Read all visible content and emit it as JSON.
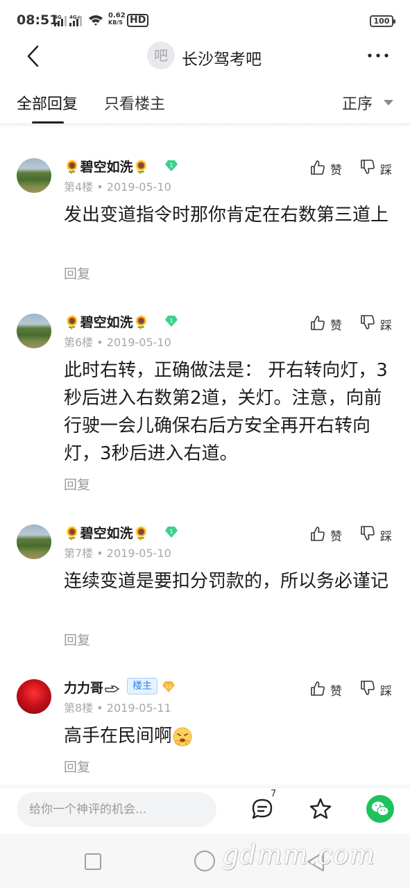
{
  "status_bar": {
    "time": "08:51",
    "network_speed_value": "0.62",
    "network_speed_unit": "KB/S",
    "hd_label": "HD",
    "battery": "100"
  },
  "header": {
    "forum_avatar_glyph": "吧",
    "forum_title": "长沙驾考吧"
  },
  "tabs": {
    "all_replies": "全部回复",
    "owner_only": "只看楼主",
    "sort": "正序"
  },
  "posts": [
    {
      "username": "🌻碧空如洗🌻",
      "level": "1",
      "floor": "第4楼",
      "date": "2019-05-10",
      "content": "发出变道指令时那你肯定在右数第三道上",
      "reply_label": "回复",
      "like_label": "赞",
      "dislike_label": "踩"
    },
    {
      "username": "🌻碧空如洗🌻",
      "level": "1",
      "floor": "第6楼",
      "date": "2019-05-10",
      "content": "此时右转，正确做法是： 开右转向灯，3秒后进入右数第2道，关灯。注意，向前行驶一会儿确保右后方安全再开右转向灯，3秒后进入右道。",
      "reply_label": "回复",
      "like_label": "赞",
      "dislike_label": "踩"
    },
    {
      "username": "🌻碧空如洗🌻",
      "level": "1",
      "floor": "第7楼",
      "date": "2019-05-10",
      "content": "连续变道是要扣分罚款的，所以务必谨记",
      "reply_label": "回复",
      "like_label": "赞",
      "dislike_label": "踩"
    },
    {
      "username": "力力哥",
      "owner_badge": "楼主",
      "level": "12",
      "floor": "第8楼",
      "date": "2019-05-11",
      "content": "高手在民间啊",
      "reply_label": "回复",
      "like_label": "赞",
      "dislike_label": "踩"
    }
  ],
  "bottom_bar": {
    "comment_placeholder": "给你一个神评的机会...",
    "comment_count": "7"
  },
  "watermark": "gdmm.com",
  "colors": {
    "level_badge_green": "#3ecf8e",
    "level_badge_gold": "#f5b83d",
    "owner_badge_blue": "#2f83e8",
    "wechat_green": "#1fc15c"
  }
}
